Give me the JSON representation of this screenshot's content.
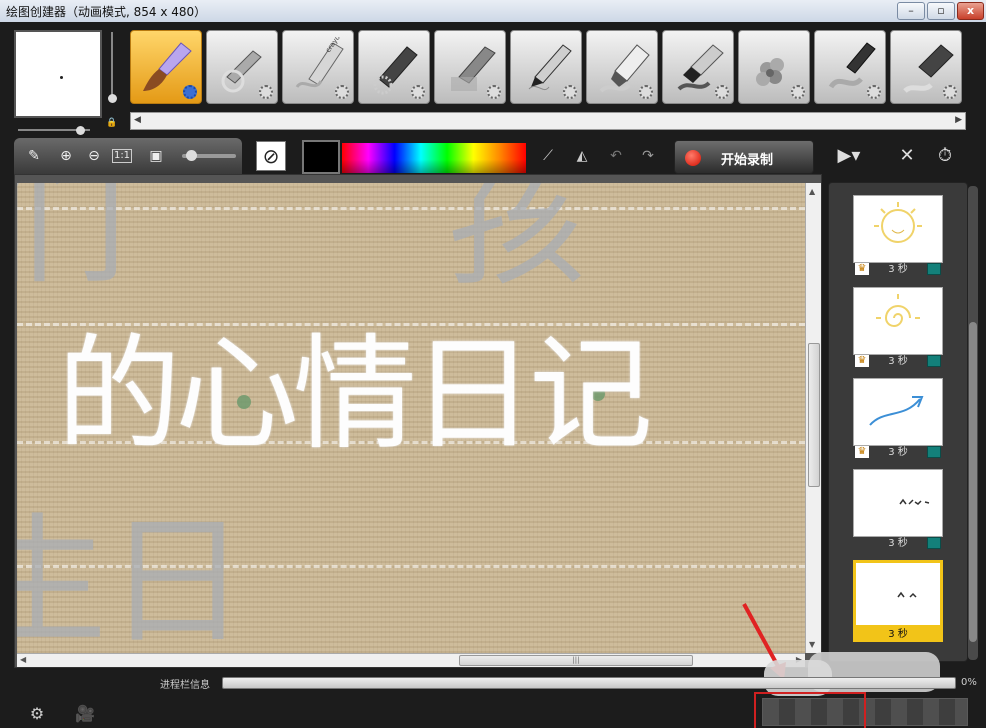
{
  "window": {
    "title": "绘图创建器（动画模式, 854 x 480）",
    "minimize": "–",
    "maximize": "▫",
    "close": "x"
  },
  "tools": [
    {
      "name": "paintbrush",
      "active": true
    },
    {
      "name": "airbrush"
    },
    {
      "name": "crayon",
      "label": "crayon"
    },
    {
      "name": "chalk"
    },
    {
      "name": "charcoal"
    },
    {
      "name": "pencil"
    },
    {
      "name": "marker"
    },
    {
      "name": "oil-paint"
    },
    {
      "name": "particle-brush"
    },
    {
      "name": "watercolor"
    },
    {
      "name": "eraser"
    }
  ],
  "toolbar": {
    "zoom_reset": "1:1",
    "no_fill_icon": "⊘",
    "record_label": "开始录制",
    "colors": {
      "current": "#000000",
      "record": "#e01a0a",
      "accent": "#f2c418"
    }
  },
  "canvas": {
    "main_text": "的心情日记",
    "background_chars": {
      "top_left": "们",
      "top_right": "孩",
      "bottom": "生日",
      "left_fragment": "l"
    }
  },
  "frames": [
    {
      "duration": "3 秒",
      "thumb": "sun-face",
      "selected": false
    },
    {
      "duration": "3 秒",
      "thumb": "sun-spiral",
      "selected": false
    },
    {
      "duration": "3 秒",
      "thumb": "blue-arrow",
      "selected": false
    },
    {
      "duration": "3 秒",
      "thumb": "text-scribble",
      "selected": false
    },
    {
      "duration": "3 秒",
      "thumb": "text-scribble-small",
      "selected": true
    }
  ],
  "status": {
    "label": "进程栏信息",
    "progress_percent": 0,
    "percent_text": "0%"
  }
}
